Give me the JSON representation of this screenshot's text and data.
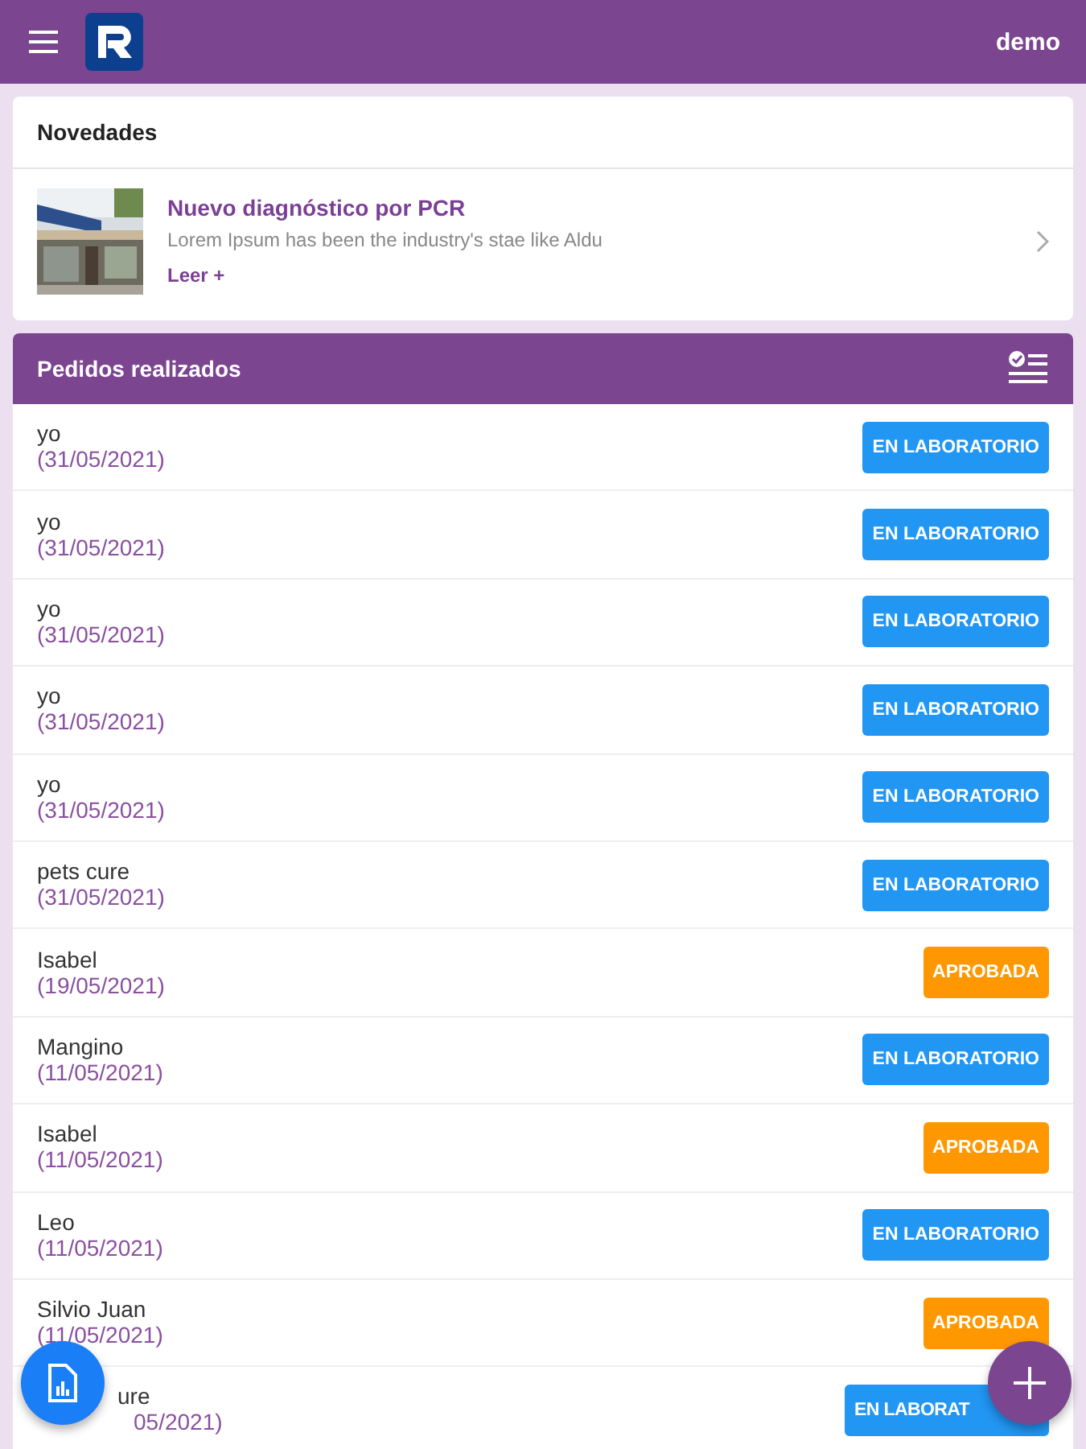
{
  "app_bar": {
    "user": "demo"
  },
  "news": {
    "title": "Novedades",
    "item": {
      "kind": "picture",
      "headline": "Nuevo diagnóstico por PCR",
      "summary": "Lorem Ipsum has been the industry's stae like Aldu",
      "link": "Leer +"
    }
  },
  "orders": {
    "title": "Pedidos realizados",
    "rows": [
      {
        "name": "yo",
        "date": "(31/05/2021)",
        "status": "EN LABORATORIO",
        "kind": "lab"
      },
      {
        "name": "yo",
        "date": "(31/05/2021)",
        "status": "EN LABORATORIO",
        "kind": "lab"
      },
      {
        "name": "yo",
        "date": "(31/05/2021)",
        "status": "EN LABORATORIO",
        "kind": "lab"
      },
      {
        "name": "yo",
        "date": "(31/05/2021)",
        "status": "EN LABORATORIO",
        "kind": "lab"
      },
      {
        "name": "yo",
        "date": "(31/05/2021)",
        "status": "EN LABORATORIO",
        "kind": "lab"
      },
      {
        "name": "pets cure",
        "date": "(31/05/2021)",
        "status": "EN LABORATORIO",
        "kind": "lab"
      },
      {
        "name": "Isabel",
        "date": "(19/05/2021)",
        "status": "APROBADA",
        "kind": "approved"
      },
      {
        "name": "Mangino",
        "date": "(11/05/2021)",
        "status": "EN LABORATORIO",
        "kind": "lab"
      },
      {
        "name": "Isabel",
        "date": "(11/05/2021)",
        "status": "APROBADA",
        "kind": "approved"
      },
      {
        "name": "Leo",
        "date": "(11/05/2021)",
        "status": "EN LABORATORIO",
        "kind": "lab"
      },
      {
        "name": "Silvio Juan",
        "date": "(11/05/2021)",
        "status": "APROBADA",
        "kind": "approved"
      },
      {
        "name": "ure",
        "date": "05/2021)",
        "status": "EN LABORAT",
        "kind": "lab"
      }
    ]
  }
}
